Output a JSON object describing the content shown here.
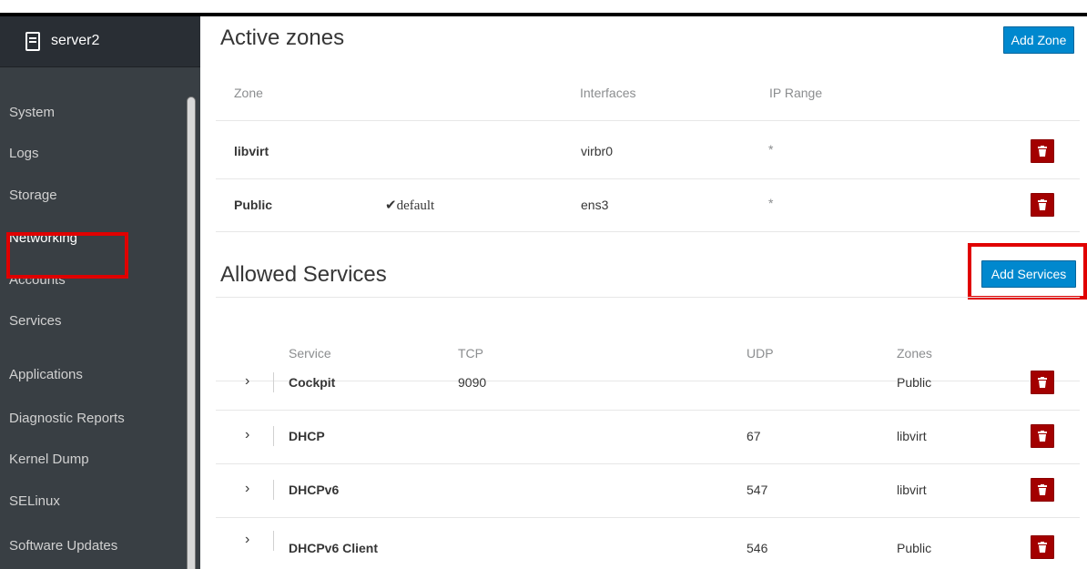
{
  "colors": {
    "accent": "#0088ce",
    "danger": "#a30000",
    "sidebar_bg": "#393f44",
    "highlight": "#e00000"
  },
  "sidebar": {
    "host": "server2",
    "items": [
      {
        "label": "System"
      },
      {
        "label": "Logs"
      },
      {
        "label": "Storage"
      },
      {
        "label": "Networking",
        "active": true
      },
      {
        "label": "Accounts"
      },
      {
        "label": "Services"
      },
      {
        "label": "Applications"
      },
      {
        "label": "Diagnostic Reports"
      },
      {
        "label": "Kernel Dump"
      },
      {
        "label": "SELinux"
      },
      {
        "label": "Software Updates"
      }
    ]
  },
  "zones": {
    "title": "Active zones",
    "add_label": "Add Zone",
    "columns": [
      "Zone",
      "Interfaces",
      "IP Range"
    ],
    "rows": [
      {
        "zone": "libvirt",
        "default": "",
        "interfaces": "virbr0",
        "ip_range": "*"
      },
      {
        "zone": "Public",
        "default": "✔default",
        "interfaces": "ens3",
        "ip_range": "*"
      }
    ]
  },
  "services": {
    "title": "Allowed Services",
    "add_label": "Add Services",
    "columns": [
      "Service",
      "TCP",
      "UDP",
      "Zones"
    ],
    "rows": [
      {
        "service": "Cockpit",
        "tcp": "9090",
        "udp": "",
        "zones": "Public"
      },
      {
        "service": "DHCP",
        "tcp": "",
        "udp": "67",
        "zones": "libvirt"
      },
      {
        "service": "DHCPv6",
        "tcp": "",
        "udp": "547",
        "zones": "libvirt"
      },
      {
        "service": "DHCPv6 Client",
        "tcp": "",
        "udp": "546",
        "zones": "Public"
      }
    ]
  }
}
